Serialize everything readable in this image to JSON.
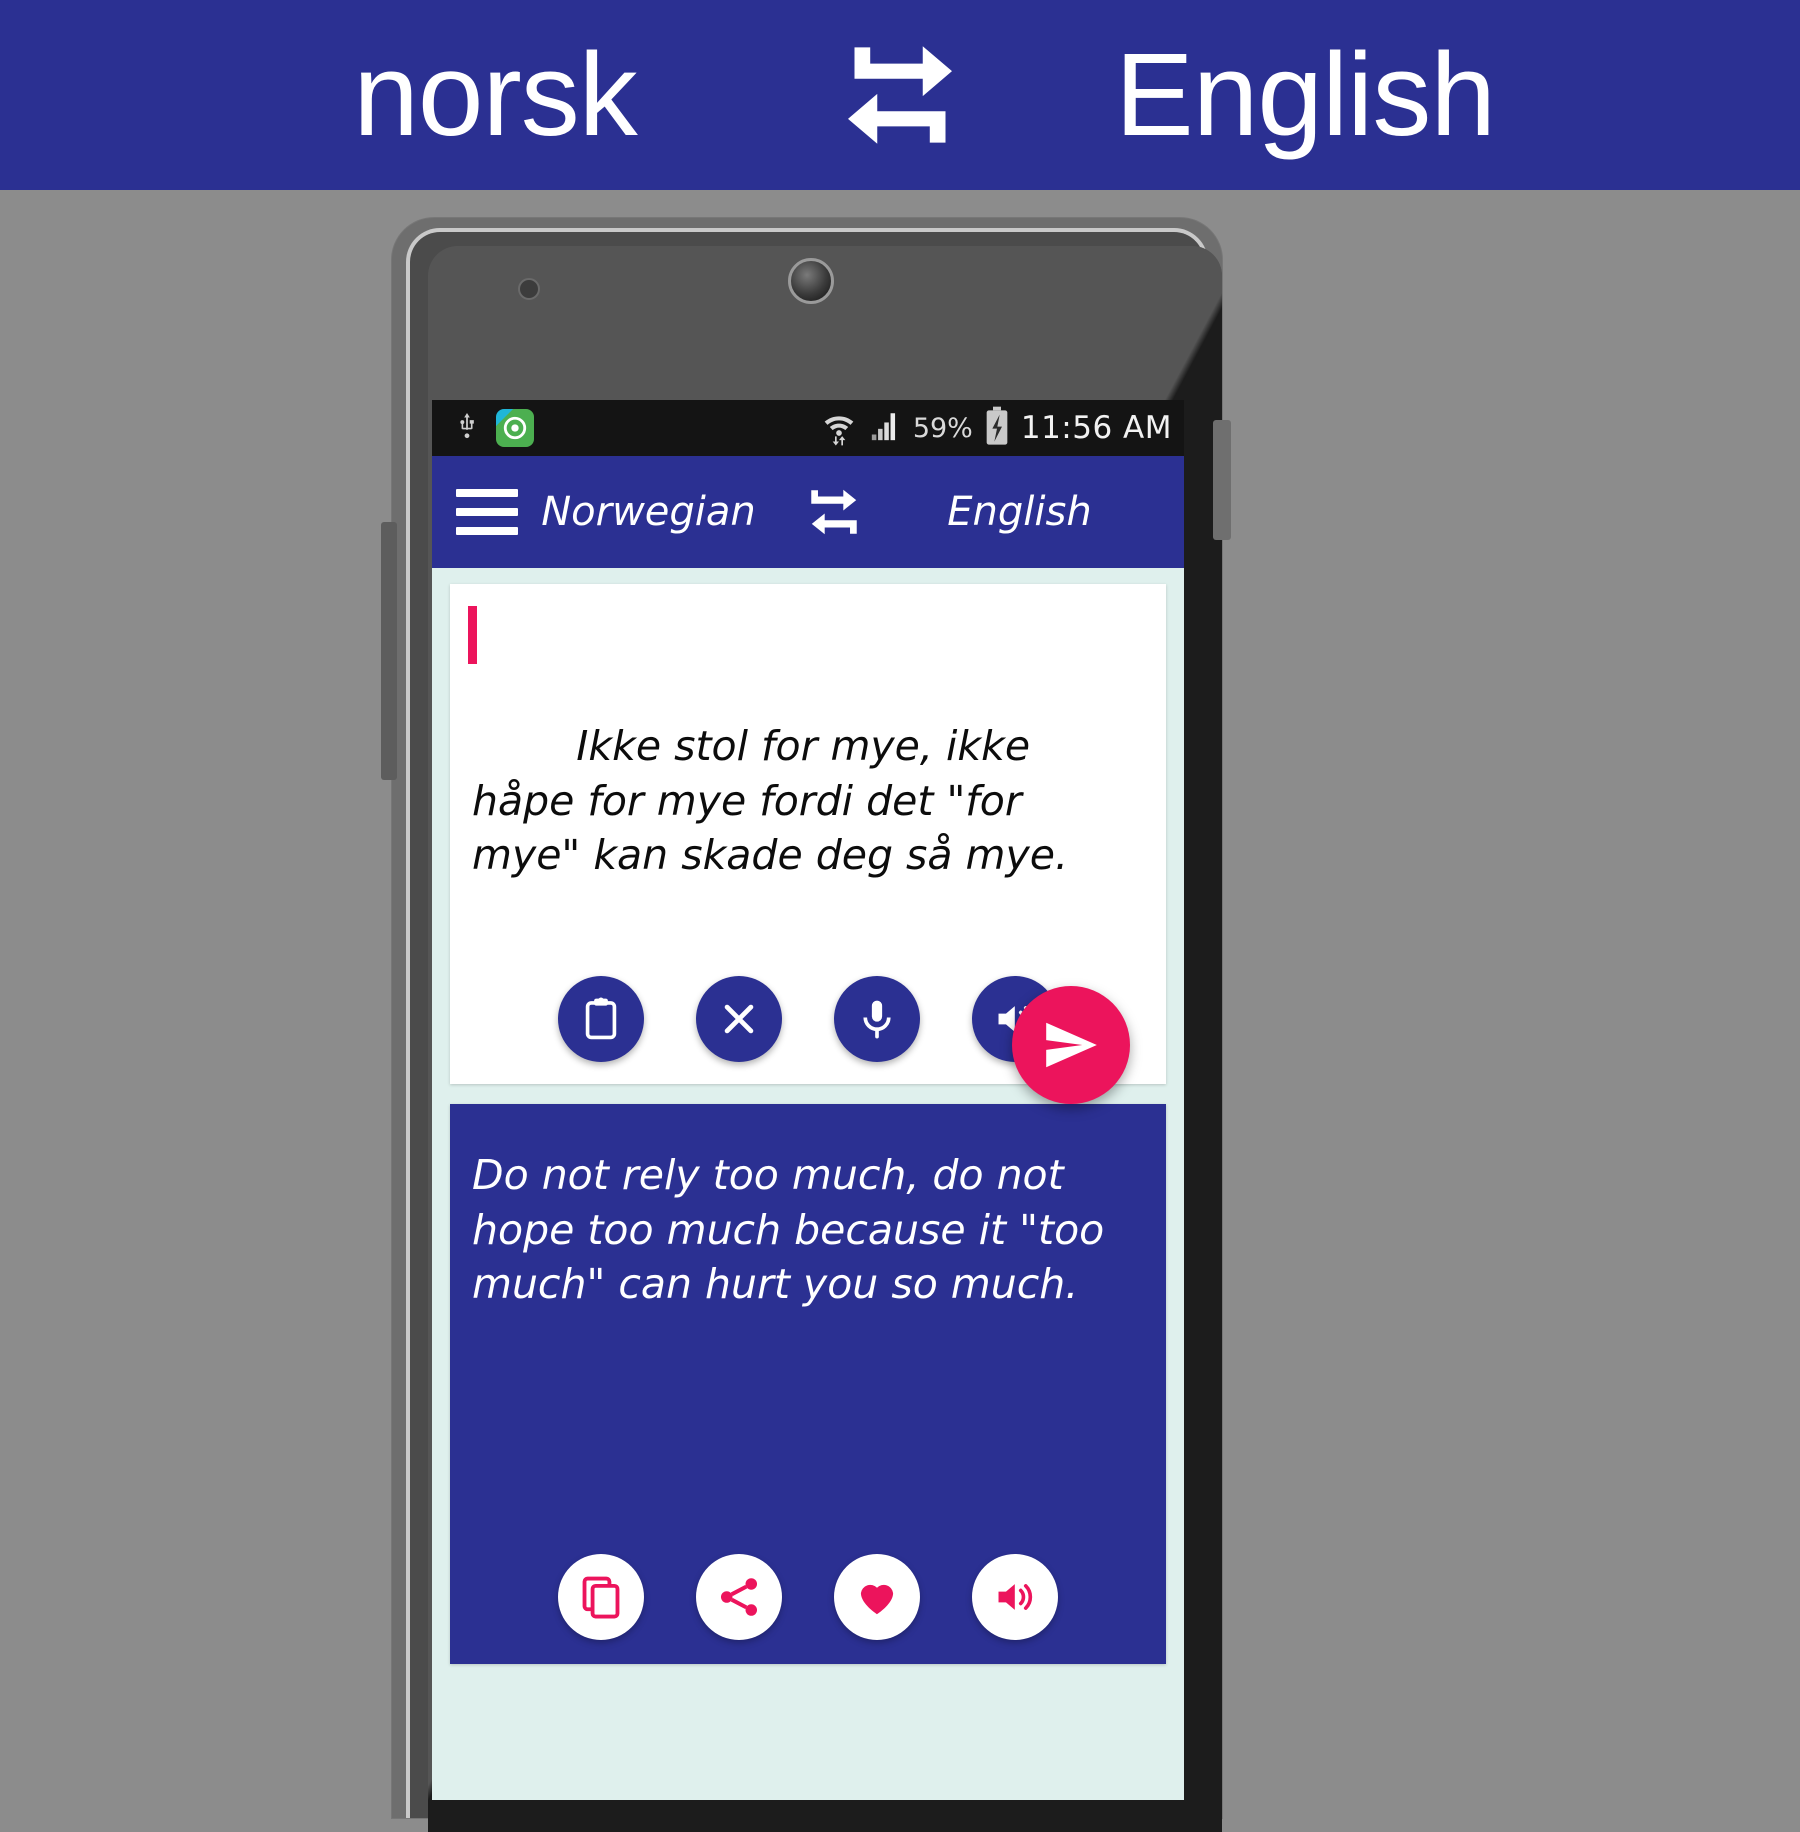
{
  "banner": {
    "source_language": "norsk",
    "target_language": "English",
    "swap_icon": "swap-repeat-icon",
    "background_color": "#2b3092"
  },
  "phone": {
    "status_bar": {
      "usb_icon": "usb-icon",
      "app_notification_icon": "green-app-icon",
      "wifi_icon": "wifi-transfer-icon",
      "signal_icon": "cellular-signal-icon",
      "battery_percent": "59%",
      "battery_icon": "battery-charging-icon",
      "time": "11:56 AM"
    },
    "app_bar": {
      "menu_icon": "hamburger-menu-icon",
      "source_language": "Norwegian",
      "swap_icon": "swap-repeat-icon",
      "target_language": "English",
      "background_color": "#2b3092"
    },
    "source_card": {
      "text": "Ikke stol for mye, ikke håpe for mye fordi det \"for mye\" kan skade deg så mye.",
      "caret_color": "#ec145c",
      "actions": [
        {
          "name": "paste-button",
          "icon": "clipboard-icon"
        },
        {
          "name": "clear-button",
          "icon": "close-x-icon"
        },
        {
          "name": "voice-input-button",
          "icon": "microphone-icon"
        },
        {
          "name": "speak-source-button",
          "icon": "speaker-icon"
        }
      ]
    },
    "translate_button": {
      "name": "translate-send-button",
      "icon": "send-arrow-icon",
      "color": "#ec145c"
    },
    "target_card": {
      "text": "Do not rely too much, do not hope too much because it \"too much\" can hurt you so much.",
      "background_color": "#2b3092",
      "actions": [
        {
          "name": "copy-button",
          "icon": "copy-icon"
        },
        {
          "name": "share-button",
          "icon": "share-icon"
        },
        {
          "name": "favorite-button",
          "icon": "heart-icon"
        },
        {
          "name": "speak-target-button",
          "icon": "speaker-icon"
        }
      ]
    }
  },
  "colors": {
    "page_background": "#8c8c8c",
    "accent_blue": "#2b3092",
    "accent_pink": "#ec145c",
    "screen_background": "#dff0ed"
  }
}
